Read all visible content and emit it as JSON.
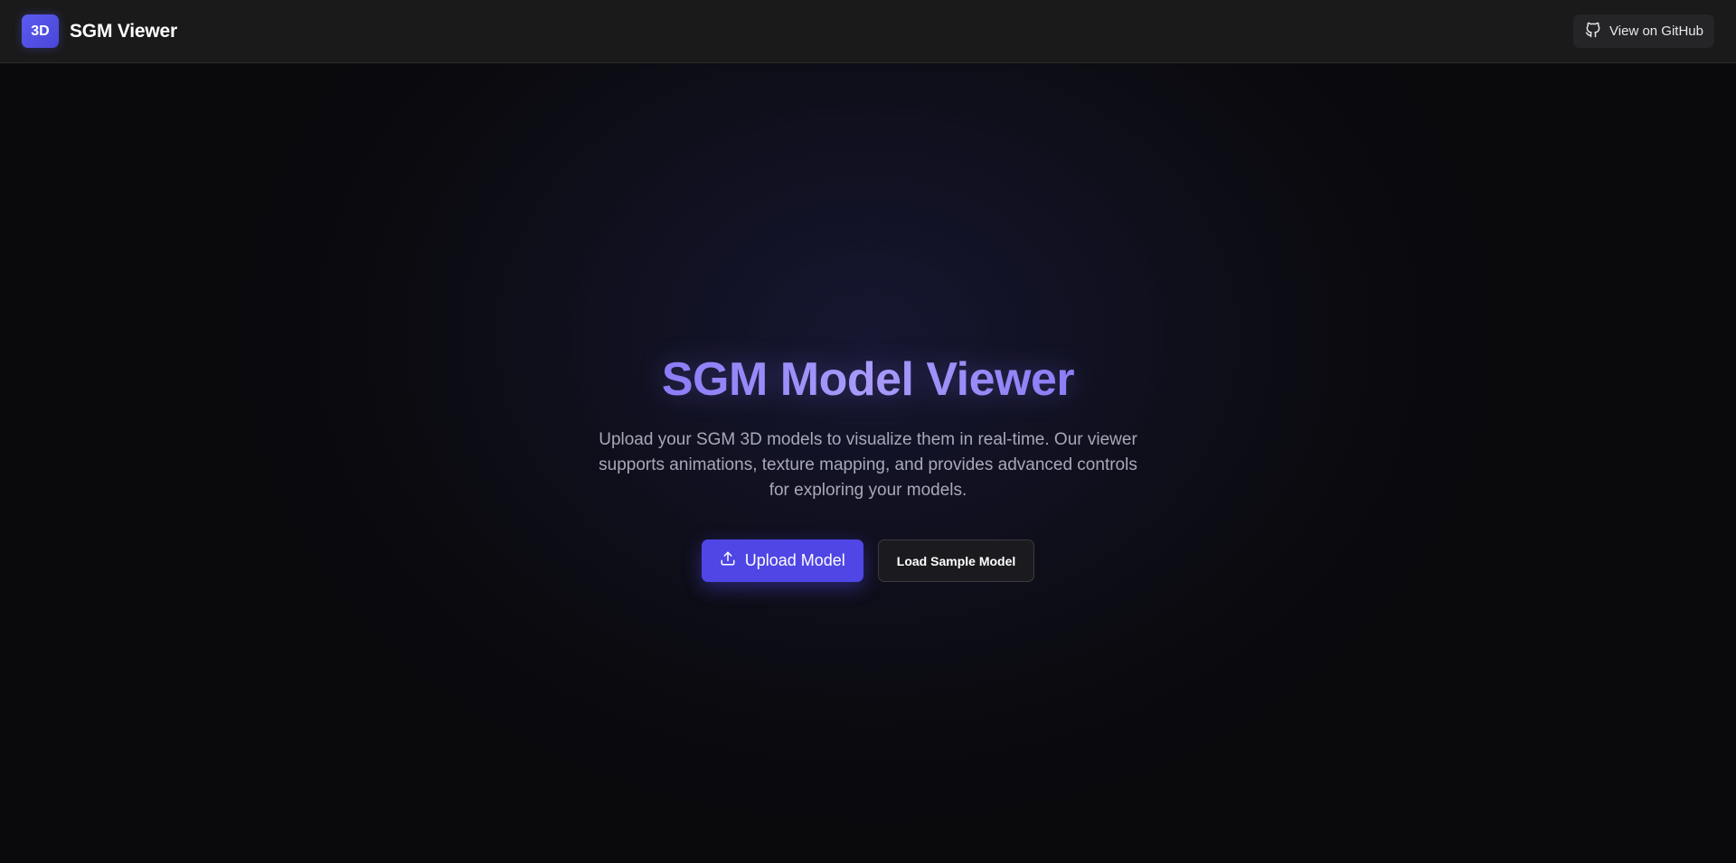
{
  "header": {
    "logo_text": "3D",
    "app_title": "SGM Viewer",
    "github_label": "View on GitHub",
    "github_icon": "github-icon"
  },
  "hero": {
    "title": "SGM Model Viewer",
    "description": "Upload your SGM 3D models to visualize them in real-time. Our viewer supports animations, texture mapping, and provides advanced controls for exploring your models.",
    "upload_label": "Upload Model",
    "upload_icon": "upload-icon",
    "sample_label": "Load Sample Model"
  },
  "colors": {
    "accent": "#4f46e5",
    "title_gradient": "#8b7cf6",
    "header_bg": "#1a1a1b",
    "page_bg": "#0a0a0d"
  }
}
